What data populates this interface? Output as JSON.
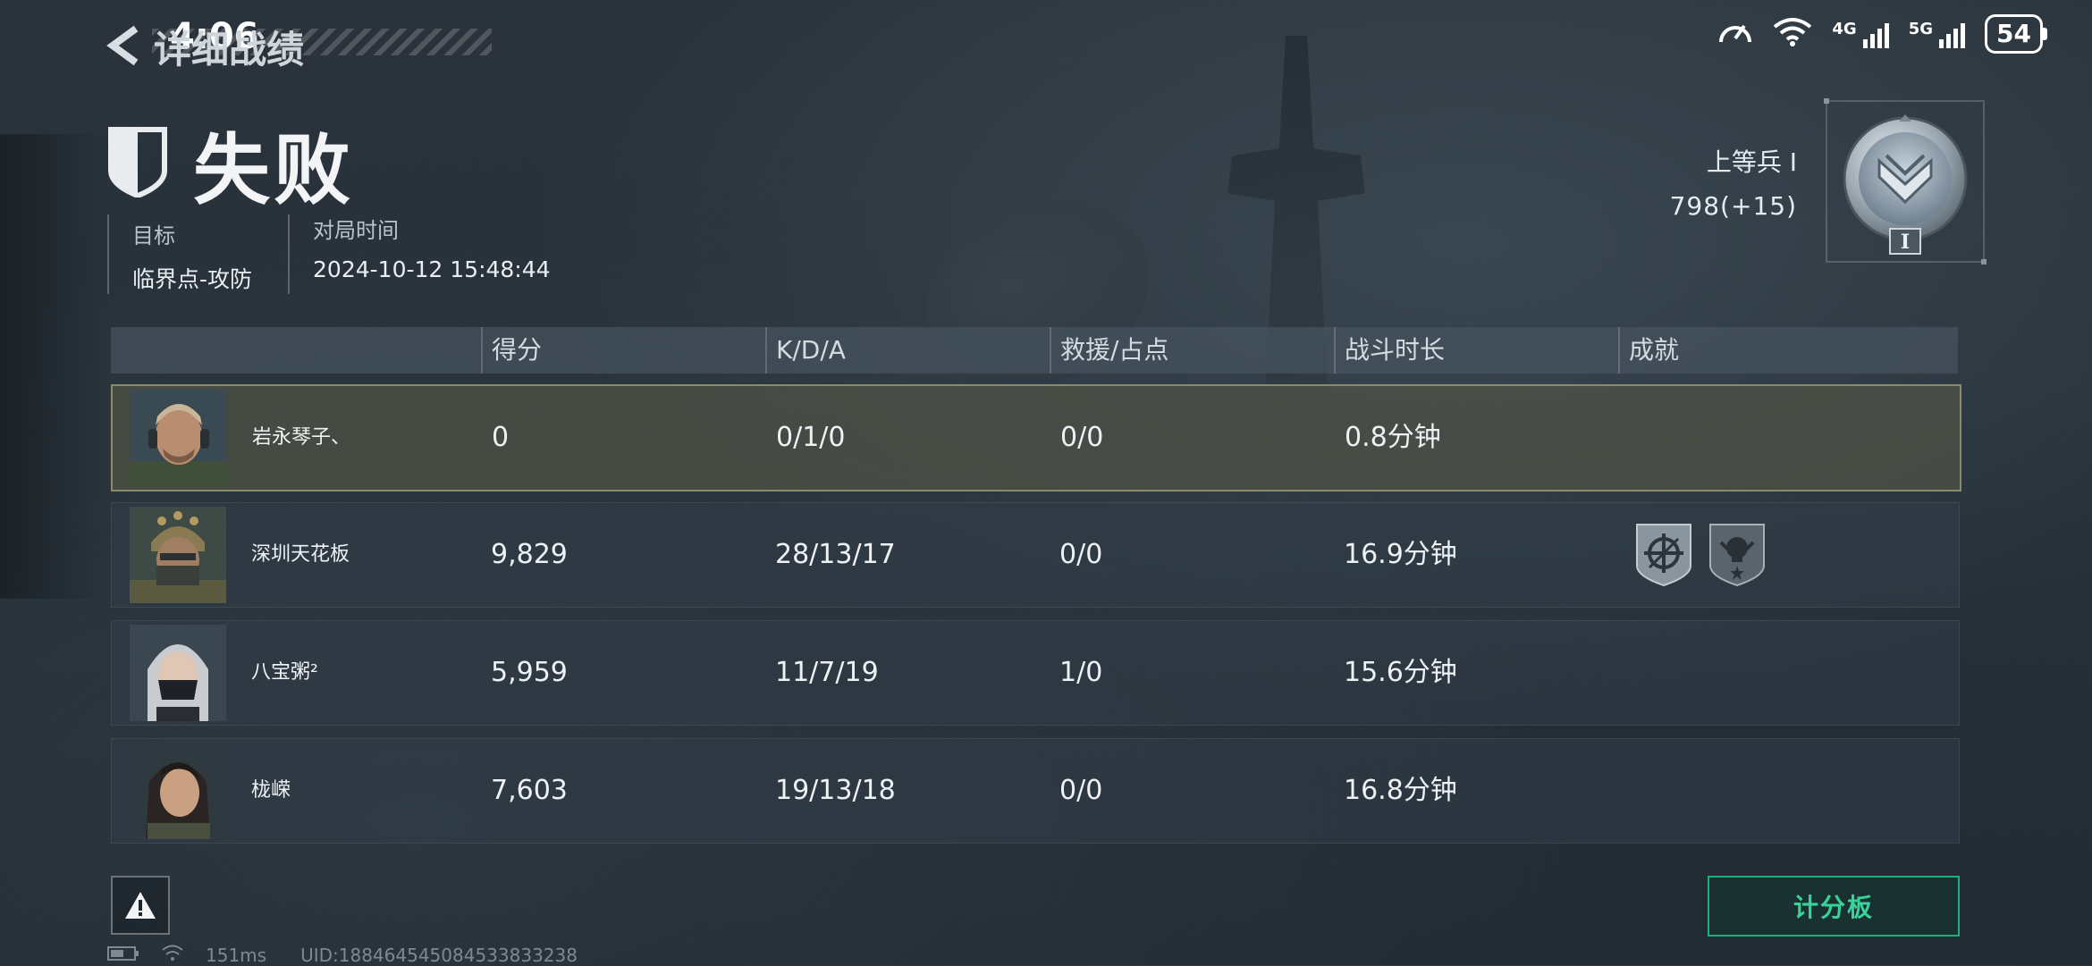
{
  "status_bar": {
    "time": "4:06",
    "network_4g": "4G",
    "network_5g": "5G",
    "battery": "54"
  },
  "header": {
    "back_title": "详细战绩",
    "result": "失败",
    "meta": {
      "target_label": "目标",
      "target_value": "临界点-攻防",
      "time_label": "对局时间",
      "time_value": "2024-10-12 15:48:44"
    },
    "rank": {
      "name": "上等兵 I",
      "points": "798(+15)",
      "badge_numeral": "I"
    }
  },
  "table": {
    "columns": [
      "得分",
      "K/D/A",
      "救援/占点",
      "战斗时长",
      "成就"
    ],
    "rows": [
      {
        "name": "岩永琴子、",
        "score": "0",
        "kda": "0/1/0",
        "rescue": "0/0",
        "duration": "0.8分钟",
        "achievements": [],
        "highlight": true
      },
      {
        "name": "深圳天花板",
        "score": "9,829",
        "kda": "28/13/17",
        "rescue": "0/0",
        "duration": "16.9分钟",
        "achievements": [
          "crosshair-badge-icon",
          "skull-badge-icon"
        ],
        "highlight": false
      },
      {
        "name": "八宝粥²",
        "score": "5,959",
        "kda": "11/7/19",
        "rescue": "1/0",
        "duration": "15.6分钟",
        "achievements": [],
        "highlight": false
      },
      {
        "name": "栊嵘",
        "score": "7,603",
        "kda": "19/13/18",
        "rescue": "0/0",
        "duration": "16.8分钟",
        "achievements": [],
        "highlight": false
      }
    ]
  },
  "actions": {
    "scoreboard": "计分板"
  },
  "footer": {
    "ping": "151ms",
    "uid": "UID:18846454508453383323​8"
  },
  "colors": {
    "accent": "#38d39a",
    "highlight_row": "#50524a"
  }
}
